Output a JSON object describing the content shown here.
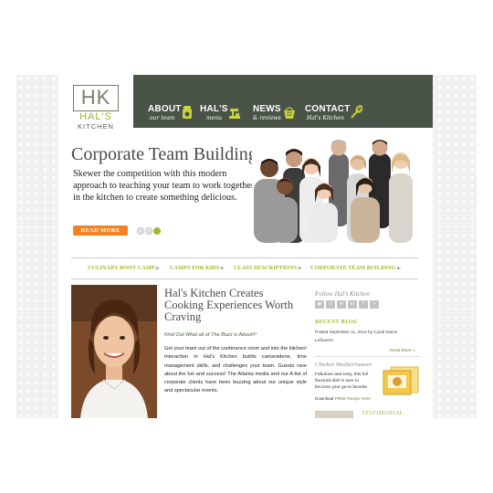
{
  "brand": {
    "logo_initials": "HK",
    "logo_name": "HAL'S",
    "logo_sub": "KITCHEN",
    "accent_color": "#a6b52d",
    "nav_color": "#4a5347",
    "button_color": "#f58220"
  },
  "nav": {
    "items": [
      {
        "title": "ABOUT",
        "sub": "our team",
        "icon": "cookie-jar-icon"
      },
      {
        "title": "HAL'S",
        "sub": "menu",
        "icon": "mixer-icon"
      },
      {
        "title": "NEWS",
        "sub": "& reviews",
        "icon": "basket-icon"
      },
      {
        "title": "CONTACT",
        "sub": "Hal's Kitchen",
        "icon": "whisk-icon"
      }
    ]
  },
  "hero": {
    "title": "Corporate Team Building",
    "text": "Skewer the competition with this modern approach to teaching your team to work together in the kitchen to create something delicious.",
    "button": "READ MORE",
    "slides": 3,
    "active_slide": 3
  },
  "subnav": {
    "items": [
      "CULINARY BOOT CAMP",
      "CAMPS FOR KIDS",
      "CLASS DESCRIPTIONS",
      "CORPORATE TEAM BUILDING"
    ]
  },
  "article": {
    "title": "Hal's Kitchen Creates Cooking Experiences Worth Craving",
    "subtitle": "Find Out What all of The Buzz is About!!!",
    "body": "Get your team out of the conference room and into the kitchen! Interaction in Hal's Kitchen builds camaraderie, time management skills, and challenges your team. Guests rave about the fun and success! The Atlanta media and our A-list of corporate clients have been buzzing about our unique style and spectacular events."
  },
  "sidebar": {
    "follow_title": "Follow Hal's Kitchen",
    "social_icons": [
      "rss-icon",
      "twitter-icon",
      "email-icon",
      "linkedin-icon",
      "facebook-icon",
      "share-icon"
    ],
    "recent_blog_title": "RECENT BLOG",
    "recent_posted": "Posted September 11, 2012 by Cyndi Stams",
    "recent_post_title": "Leftovers",
    "read_more": "Read More »",
    "recipe_title": "Chicken Mediterranean",
    "recipe_text": "Fabulous and easy, this full flavored dish is sure to become your go-to favorite",
    "download_label": "Download",
    "download_link": "FREE Recipe Here",
    "testimonial_title": "TESTIMONIAL"
  }
}
